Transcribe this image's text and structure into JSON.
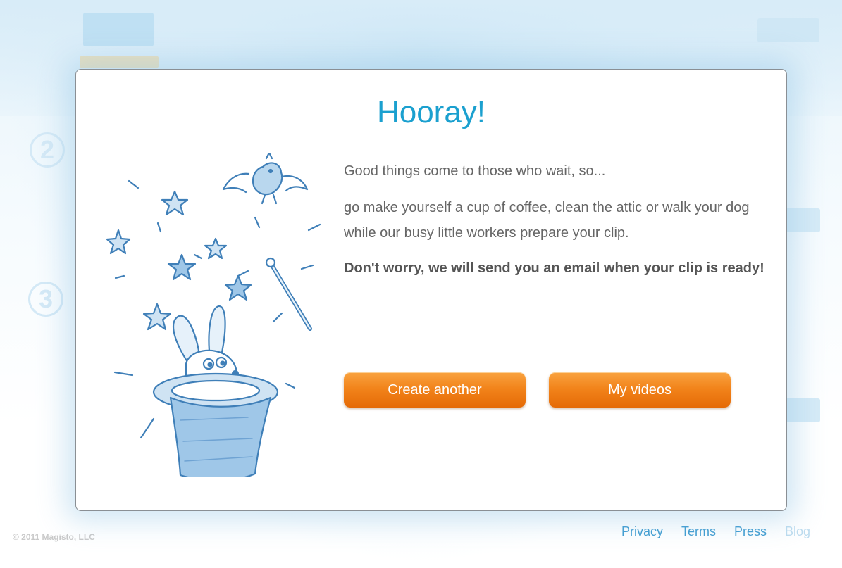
{
  "background": {
    "steps": [
      "2",
      "3"
    ],
    "copyright": "© 2011 Magisto, LLC",
    "footer_links": [
      "Privacy",
      "Terms",
      "Press",
      "Blog"
    ]
  },
  "modal": {
    "title": "Hooray!",
    "line1": "Good things come to those who wait, so...",
    "line2": "go make yourself a cup of coffee, clean the attic or walk your dog while our busy little workers prepare your clip.",
    "line3": "Don't worry, we will send you an email when your clip is ready!",
    "buttons": {
      "create_another": "Create another",
      "my_videos": "My videos"
    }
  },
  "colors": {
    "title": "#1ba0cf",
    "button_orange": "#f2841b",
    "link": "#3d9bd0"
  },
  "icons": [
    "magic-hat-bunny-illustration"
  ]
}
